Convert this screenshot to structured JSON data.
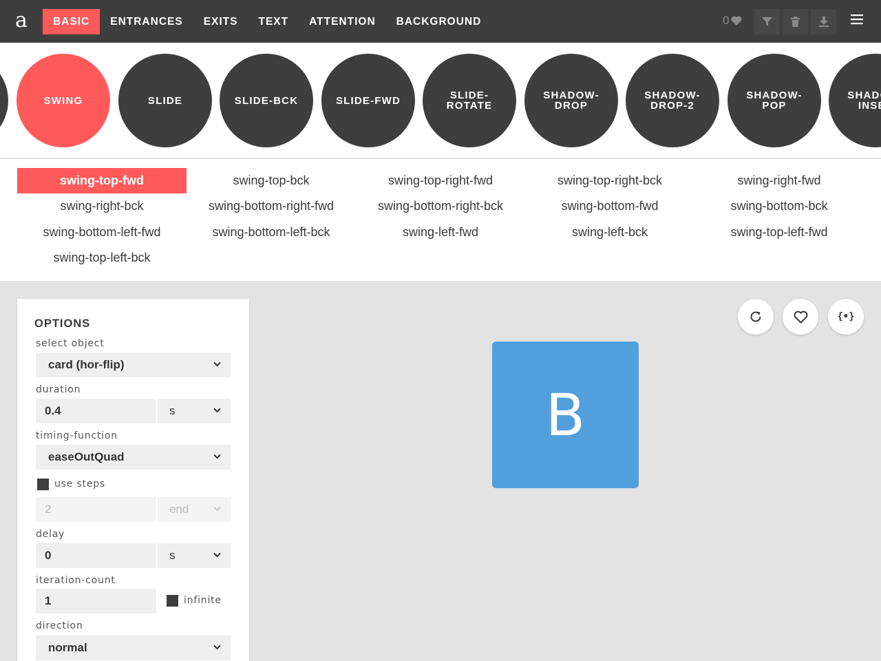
{
  "app": {
    "logo": "a"
  },
  "nav": {
    "items": [
      {
        "label": "BASIC",
        "active": true
      },
      {
        "label": "ENTRANCES"
      },
      {
        "label": "EXITS"
      },
      {
        "label": "TEXT"
      },
      {
        "label": "ATTENTION"
      },
      {
        "label": "BACKGROUND"
      }
    ],
    "fav_count": "0"
  },
  "toolbar": {
    "icons": [
      "heart-icon",
      "filter-icon",
      "trash-icon",
      "download-icon",
      "hamburger-menu-icon"
    ]
  },
  "animations": [
    {
      "label": "SWING",
      "active": true
    },
    {
      "label": "SLIDE"
    },
    {
      "label": "SLIDE-BCK"
    },
    {
      "label": "SLIDE-FWD"
    },
    {
      "label": "SLIDE-ROTATE"
    },
    {
      "label": "SHADOW-DROP"
    },
    {
      "label": "SHADOW-DROP-2"
    },
    {
      "label": "SHADOW-POP"
    },
    {
      "label": "SHADOW-INSET"
    }
  ],
  "variants": [
    {
      "label": "swing-top-fwd",
      "active": true
    },
    {
      "label": "swing-top-bck"
    },
    {
      "label": "swing-top-right-fwd"
    },
    {
      "label": "swing-top-right-bck"
    },
    {
      "label": "swing-right-fwd"
    },
    {
      "label": "swing-right-bck"
    },
    {
      "label": "swing-bottom-right-fwd"
    },
    {
      "label": "swing-bottom-right-bck"
    },
    {
      "label": "swing-bottom-fwd"
    },
    {
      "label": "swing-bottom-bck"
    },
    {
      "label": "swing-bottom-left-fwd"
    },
    {
      "label": "swing-bottom-left-bck"
    },
    {
      "label": "swing-left-fwd"
    },
    {
      "label": "swing-left-bck"
    },
    {
      "label": "swing-top-left-fwd"
    },
    {
      "label": "swing-top-left-bck"
    }
  ],
  "options": {
    "title": "OPTIONS",
    "select_object": {
      "label": "select object",
      "value": "card (hor-flip)"
    },
    "duration": {
      "label": "duration",
      "value": "0.4",
      "unit": "s"
    },
    "timing_function": {
      "label": "timing-function",
      "value": "easeOutQuad"
    },
    "use_steps": {
      "label": "use steps",
      "checked": false,
      "count": "2",
      "position": "end"
    },
    "delay": {
      "label": "delay",
      "value": "0",
      "unit": "s"
    },
    "iteration_count": {
      "label": "iteration-count",
      "value": "1",
      "infinite_label": "infinite",
      "infinite_checked": false
    },
    "direction": {
      "label": "direction",
      "value": "normal"
    }
  },
  "stage": {
    "card_letter": "B",
    "card_color": "#529fdd",
    "code_button_label": "{•}"
  },
  "colors": {
    "accent": "#ff5a5a",
    "dark": "#3e3e3e"
  }
}
